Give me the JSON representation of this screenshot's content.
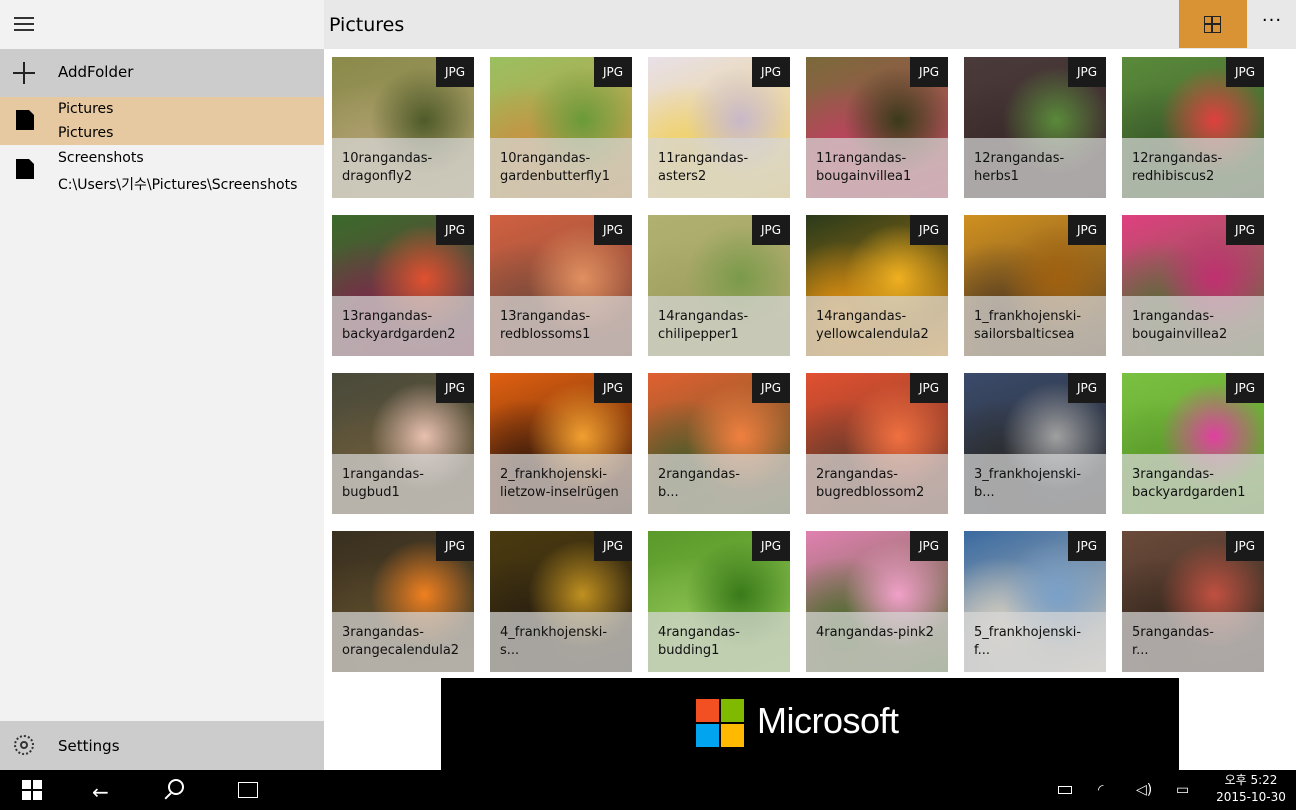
{
  "header": {
    "title": "Pictures",
    "more_label": "···"
  },
  "sidebar": {
    "add_folder_label": "AddFolder",
    "folders": [
      {
        "name": "Pictures",
        "path": "Pictures",
        "selected": true
      },
      {
        "name": "Screenshots",
        "path": "C:\\Users\\기수\\Pictures\\Screenshots",
        "selected": false
      }
    ],
    "settings_label": "Settings"
  },
  "badge_label": "JPG",
  "tiles": [
    {
      "line1": "10rangandas-",
      "line2": "dragonfly2",
      "colors": [
        "#8a8a4a",
        "#4f5a2a",
        "#b0a070"
      ]
    },
    {
      "line1": "10rangandas-",
      "line2": "gardenbutterfly1",
      "colors": [
        "#9ac060",
        "#6a9a3a",
        "#c89040"
      ]
    },
    {
      "line1": "11rangandas-",
      "line2": "asters2",
      "colors": [
        "#e8e0e8",
        "#c8b8c8",
        "#f0d060"
      ]
    },
    {
      "line1": "11rangandas-",
      "line2": "bougainvillea1",
      "colors": [
        "#7a6a3a",
        "#3a3a1a",
        "#c04060"
      ]
    },
    {
      "line1": "12rangandas-",
      "line2": "herbs1",
      "colors": [
        "#4a3a3a",
        "#5a8a3a",
        "#3a2a2a"
      ]
    },
    {
      "line1": "12rangandas-",
      "line2": "redhibiscus2",
      "colors": [
        "#5a8a3a",
        "#e04040",
        "#3a5a2a"
      ]
    },
    {
      "line1": "13rangandas-",
      "line2": "backyardgarden2",
      "colors": [
        "#3a6a2a",
        "#e05030",
        "#7a2a4a"
      ]
    },
    {
      "line1": "13rangandas-",
      "line2": "redblossoms1",
      "colors": [
        "#d06040",
        "#e09060",
        "#7a4a3a"
      ]
    },
    {
      "line1": "14rangandas-",
      "line2": "chilipepper1",
      "colors": [
        "#b0b070",
        "#7a9a4a",
        "#a0a060"
      ]
    },
    {
      "line1": "14rangandas-",
      "line2": "yellowcalendula2",
      "colors": [
        "#2a3a1a",
        "#f0b020",
        "#e09010"
      ]
    },
    {
      "line1": "1_frankhojenski-",
      "line2": "sailorsbalticsea",
      "colors": [
        "#d09020",
        "#a06010",
        "#5a4020"
      ]
    },
    {
      "line1": "1rangandas-",
      "line2": "bougainvillea2",
      "colors": [
        "#e04080",
        "#c03070",
        "#5a6a3a"
      ]
    },
    {
      "line1": "1rangandas-",
      "line2": "bugbud1",
      "colors": [
        "#4a4a3a",
        "#e8c0b0",
        "#6a5a3a"
      ]
    },
    {
      "line1": "2_frankhojenski-",
      "line2": "lietzow-inselrügen",
      "colors": [
        "#e06010",
        "#f0a030",
        "#3a1a0a"
      ]
    },
    {
      "line1": "2rangandas-",
      "line2": "b...",
      "colors": [
        "#e06030",
        "#f08040",
        "#4a5a2a"
      ]
    },
    {
      "line1": "2rangandas-",
      "line2": "bugredblossom2",
      "colors": [
        "#e05030",
        "#f07040",
        "#6a3a2a"
      ]
    },
    {
      "line1": "3_frankhojenski-",
      "line2": "b...",
      "colors": [
        "#3a4a6a",
        "#a0a0a0",
        "#2a2a2a"
      ]
    },
    {
      "line1": "3rangandas-",
      "line2": "backyardgarden1",
      "colors": [
        "#7ac040",
        "#e040a0",
        "#5a9a2a"
      ]
    },
    {
      "line1": "3rangandas-",
      "line2": "orangecalendula2",
      "colors": [
        "#3a3020",
        "#f08020",
        "#5a4a2a"
      ]
    },
    {
      "line1": "4_frankhojenski-",
      "line2": "s...",
      "colors": [
        "#4a3a10",
        "#c09020",
        "#2a2010"
      ]
    },
    {
      "line1": "4rangandas-",
      "line2": "budding1",
      "colors": [
        "#5a9a2a",
        "#3a7a1a",
        "#8ac050"
      ]
    },
    {
      "line1": "4rangandas-pink2",
      "line2": "",
      "colors": [
        "#e080b0",
        "#f0a0c8",
        "#4a6a2a"
      ]
    },
    {
      "line1": "5_frankhojenski-",
      "line2": "f...",
      "colors": [
        "#3a6aa0",
        "#7aa0c8",
        "#d8d0c0"
      ]
    },
    {
      "line1": "5rangandas-",
      "line2": "r...",
      "colors": [
        "#6a4a3a",
        "#c05040",
        "#3a2a20"
      ]
    }
  ],
  "ad": {
    "brand": "Microsoft"
  },
  "taskbar": {
    "time": "오후 5:22",
    "date": "2015-10-30"
  }
}
